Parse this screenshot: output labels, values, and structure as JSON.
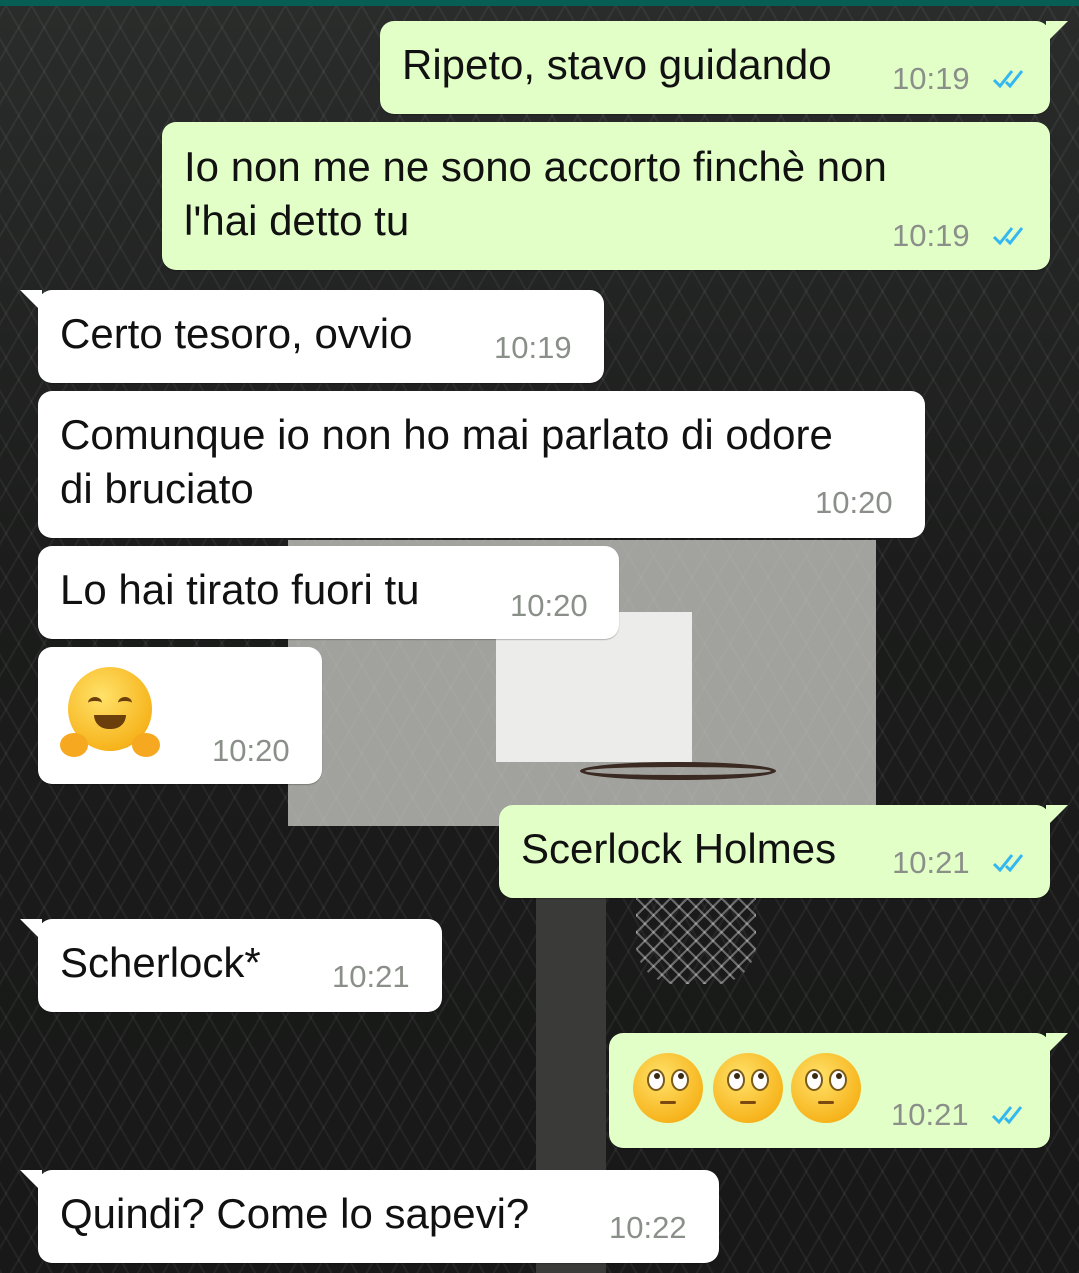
{
  "colors": {
    "outgoing_bubble": "#e2ffc7",
    "incoming_bubble": "#ffffff",
    "read_ticks": "#34b7f1",
    "header": "#075e54"
  },
  "messages": [
    {
      "direction": "out",
      "text_lines": [
        "Ripeto, stavo guidando"
      ],
      "time": "10:19",
      "status_icon": "double-check-read-icon"
    },
    {
      "direction": "out",
      "text_lines": [
        "Io non me ne sono accorto finchè non",
        "l'hai detto tu"
      ],
      "time": "10:19",
      "status_icon": "double-check-read-icon"
    },
    {
      "direction": "in",
      "text_lines": [
        "Certo tesoro, ovvio"
      ],
      "time": "10:19"
    },
    {
      "direction": "in",
      "text_lines": [
        "Comunque io non ho mai parlato di odore",
        "di bruciato"
      ],
      "time": "10:20"
    },
    {
      "direction": "in",
      "text_lines": [
        "Lo hai tirato fuori tu"
      ],
      "time": "10:20"
    },
    {
      "direction": "in",
      "emoji": [
        "hugging-face-emoji"
      ],
      "time": "10:20"
    },
    {
      "direction": "out",
      "text_lines": [
        "Scerlock Holmes"
      ],
      "time": "10:21",
      "status_icon": "double-check-read-icon"
    },
    {
      "direction": "in",
      "text_lines": [
        "Scherlock*"
      ],
      "time": "10:21"
    },
    {
      "direction": "out",
      "emoji": [
        "eye-roll-emoji",
        "eye-roll-emoji",
        "eye-roll-emoji"
      ],
      "time": "10:21",
      "status_icon": "double-check-read-icon"
    },
    {
      "direction": "in",
      "text_lines": [
        "Quindi? Come lo sapevi?"
      ],
      "time": "10:22"
    }
  ]
}
